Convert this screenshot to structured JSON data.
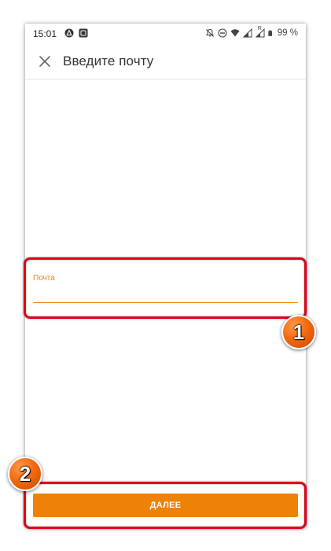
{
  "status_bar": {
    "time": "15:01",
    "battery_text": "99 %",
    "left_icons": [
      "app-notification-icon",
      "screenshot-notification-icon"
    ],
    "right_icons": [
      "mute-icon",
      "do-not-disturb-icon",
      "wifi-icon",
      "signal-icon",
      "roaming-signal-icon",
      "battery-icon"
    ],
    "roaming_mark": "R"
  },
  "app_bar": {
    "title": "Введите почту",
    "close_icon": "close-icon"
  },
  "email_field": {
    "label": "Почта",
    "value": "",
    "placeholder": ""
  },
  "next_button": {
    "label": "ДАЛЕЕ"
  },
  "annotations": {
    "badge_1": "1",
    "badge_2": "2"
  },
  "colors": {
    "accent": "#ee8208",
    "highlight": "#e0001b",
    "badge": "#f26a10"
  }
}
